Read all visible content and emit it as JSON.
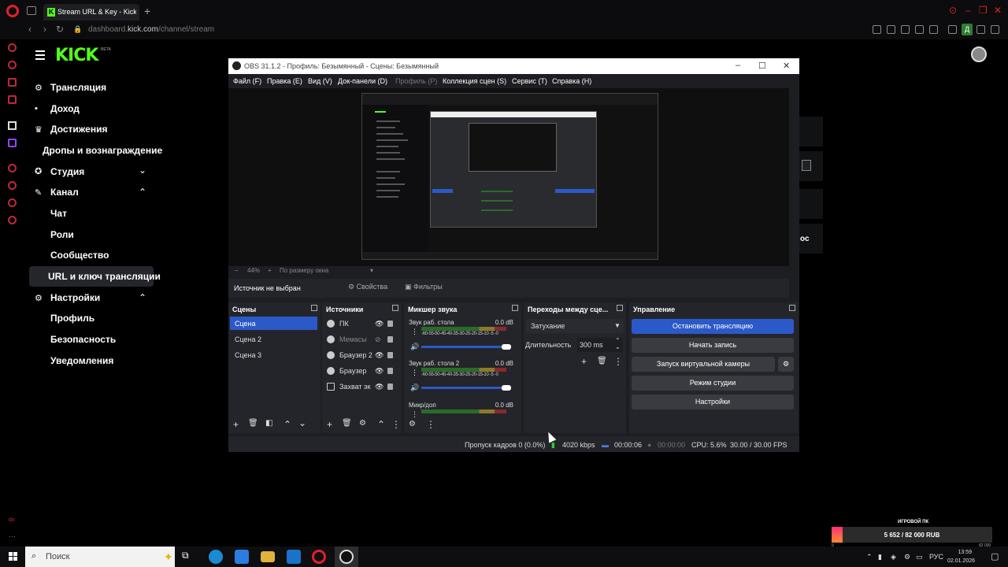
{
  "browser": {
    "tab_title": "Stream URL & Key - Kick D",
    "url_prefix": "dashboard.",
    "url_host": "kick.com",
    "url_path": "/channel/stream",
    "profile_badge": "Д"
  },
  "kick": {
    "logo": "KICK",
    "beta": "BETA",
    "nav": {
      "broadcast": "Трансляция",
      "income": "Доход",
      "achievements": "Достижения",
      "drops": "Дропы и вознаграждение",
      "studio": "Студия",
      "channel": "Канал",
      "chat": "Чат",
      "roles": "Роли",
      "community": "Сообщество",
      "url_key": "URL и ключ трансляции",
      "settings": "Настройки",
      "profile": "Профиль",
      "security": "Безопасность",
      "notifications": "Уведомления"
    },
    "right_fragment": "ос"
  },
  "obs": {
    "title": "OBS 31.1.2 - Профиль: Безымянный - Сцены: Безымянный",
    "menu": [
      "Файл (F)",
      "Правка (E)",
      "Вид (V)",
      "Док-панели (D)",
      "Профиль (P)",
      "Коллекция сцен (S)",
      "Сервис (T)",
      "Справка (H)"
    ],
    "zoom": "44%",
    "fit_label": "По размеру окна",
    "no_source": "Источник не выбран",
    "properties": "Свойства",
    "filters": "Фильтры",
    "docks": {
      "scenes": "Сцены",
      "sources": "Источники",
      "mixer": "Микшер звука",
      "transitions": "Переходы между сце...",
      "controls": "Управление"
    },
    "scenes": [
      "Сцена",
      "Сцена 2",
      "Сцена 3"
    ],
    "sources": [
      "ПК",
      "Мемасы",
      "Браузер 2",
      "Браузер",
      "Захват эк"
    ],
    "mixer": [
      {
        "name": "Звук раб. стола",
        "db": "0.0 dB"
      },
      {
        "name": "Звук раб. стола 2",
        "db": "0.0 dB"
      },
      {
        "name": "Микр/доп",
        "db": "0.0 dB"
      }
    ],
    "meter_scale": "-60-55-50-45-40-35-30-25-20-15-10 -5 -0",
    "transition": {
      "type": "Затухание",
      "duration_label": "Длительность",
      "duration_value": "300 ms"
    },
    "controls": {
      "stop_stream": "Остановить трансляцию",
      "start_record": "Начать запись",
      "virtual_cam": "Запуск виртуальной камеры",
      "studio_mode": "Режим студии",
      "settings": "Настройки"
    },
    "status": {
      "dropped": "Пропуск кадров 0 (0.0%)",
      "bitrate": "4020 kbps",
      "stream_time": "00:00:06",
      "rec_time": "00:00:00",
      "cpu": "CPU: 5.6%",
      "fps": "30.00 / 30.00 FPS"
    }
  },
  "donation": {
    "label": "ИГРОВОЙ ПК",
    "text": "5 652 / 82 000 RUB",
    "progress": 0.069,
    "min": "0",
    "max": "82 000"
  },
  "taskbar": {
    "search_placeholder": "Поиск",
    "lang": "РУС",
    "time": "13:59",
    "date": "02.01.2026"
  }
}
